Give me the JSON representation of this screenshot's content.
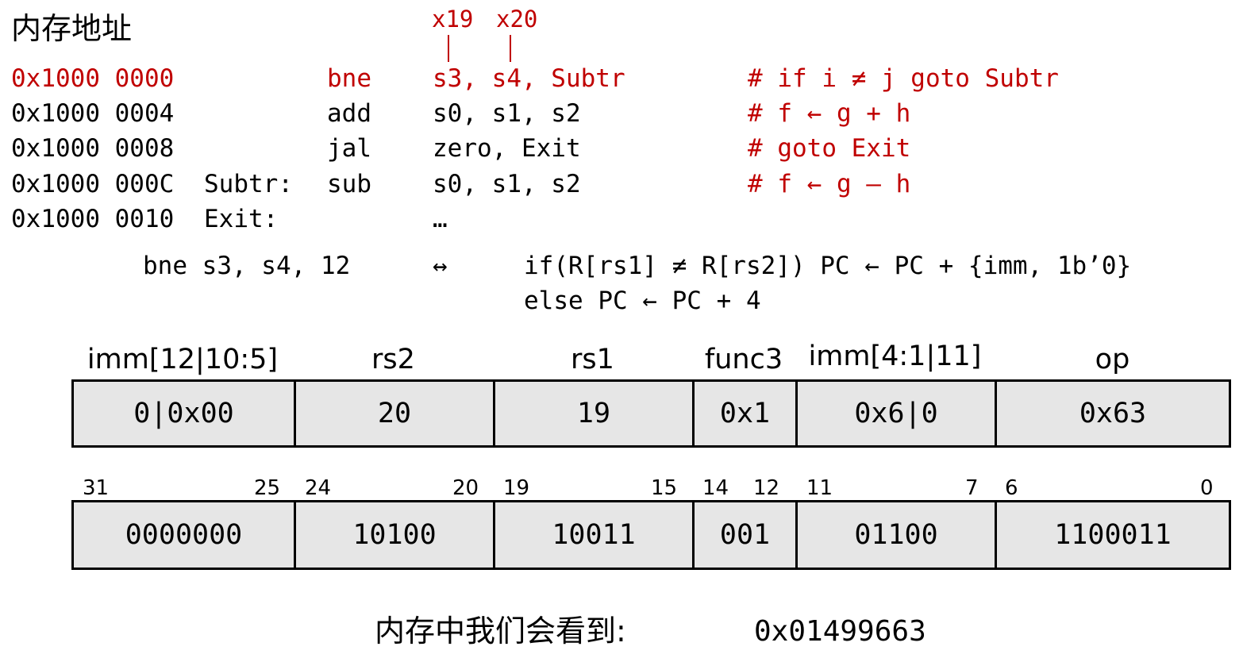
{
  "header": {
    "memory_address_title": "内存地址"
  },
  "reg_labels": {
    "x19": "x19",
    "x20": "x20"
  },
  "code_rows": [
    {
      "addr": "0x1000 0000",
      "label": "",
      "op": "bne",
      "args": "s3, s4, Subtr",
      "comment": "# if i ≠ j goto Subtr"
    },
    {
      "addr": "0x1000 0004",
      "label": "",
      "op": "add",
      "args": "s0, s1, s2",
      "comment": "# f ← g + h"
    },
    {
      "addr": "0x1000 0008",
      "label": "",
      "op": "jal",
      "args": "zero, Exit",
      "comment": "# goto Exit"
    },
    {
      "addr": "0x1000 000C",
      "label": "Subtr:",
      "op": "sub",
      "args": "s0, s1, s2",
      "comment": "# f ← g – h"
    },
    {
      "addr": "0x1000 0010",
      "label": "Exit:",
      "op": "",
      "args": "…",
      "comment": ""
    }
  ],
  "semantics": {
    "instr": "bne s3, s4, 12",
    "arrow": "↔",
    "line1": "if(R[rs1] ≠ R[rs2]) PC ← PC + {imm, 1b’0}",
    "line2": "else PC ← PC + 4"
  },
  "fields": [
    {
      "name": "imm[12|10:5]",
      "value": "0|0x00",
      "hi": "31",
      "lo": "25",
      "bits": "0000000"
    },
    {
      "name": "rs2",
      "value": "20",
      "hi": "24",
      "lo": "20",
      "bits": "10100"
    },
    {
      "name": "rs1",
      "value": "19",
      "hi": "19",
      "lo": "15",
      "bits": "10011"
    },
    {
      "name": "func3",
      "value": "0x1",
      "hi": "14",
      "lo": "12",
      "bits": "001"
    },
    {
      "name": "imm[4:1|11]",
      "value": "0x6|0",
      "hi": "11",
      "lo": "7",
      "bits": "01100"
    },
    {
      "name": "op",
      "value": "0x63",
      "hi": "6",
      "lo": "0",
      "bits": "1100011"
    }
  ],
  "footer": {
    "label": "内存中我们会看到:",
    "value": "0x01499663"
  }
}
